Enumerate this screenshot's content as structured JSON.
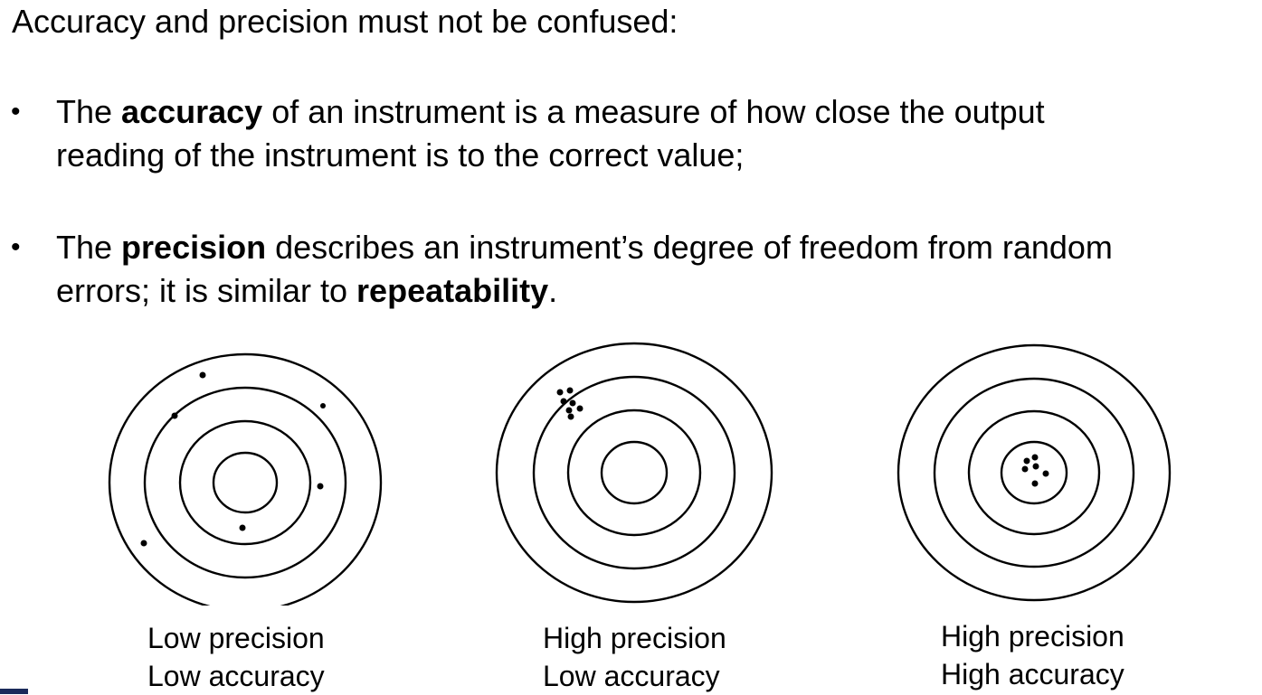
{
  "heading": "Accuracy and precision must not be confused:",
  "bullet_symbol": "•",
  "bullets": [
    {
      "lines": [
        [
          "The ",
          "accuracy",
          " of an instrument is a measure of how close the output"
        ],
        [
          "reading of the instrument is to the correct value;"
        ]
      ]
    },
    {
      "lines": [
        [
          "The ",
          "precision",
          " describes an instrument’s degree of freedom from random"
        ],
        [
          "errors; it is similar to ",
          "repeatability",
          "."
        ]
      ]
    }
  ],
  "targets": [
    {
      "caption_line1": "Low precision",
      "caption_line2": "Low accuracy",
      "shots": "scattered"
    },
    {
      "caption_line1": "High precision",
      "caption_line2": "Low accuracy",
      "shots": "clustered-off-center"
    },
    {
      "caption_line1": "High precision",
      "caption_line2": "High accuracy",
      "shots": "clustered-center"
    }
  ],
  "colors": {
    "ink": "#000000",
    "corner_accent": "#1a2a5a"
  }
}
